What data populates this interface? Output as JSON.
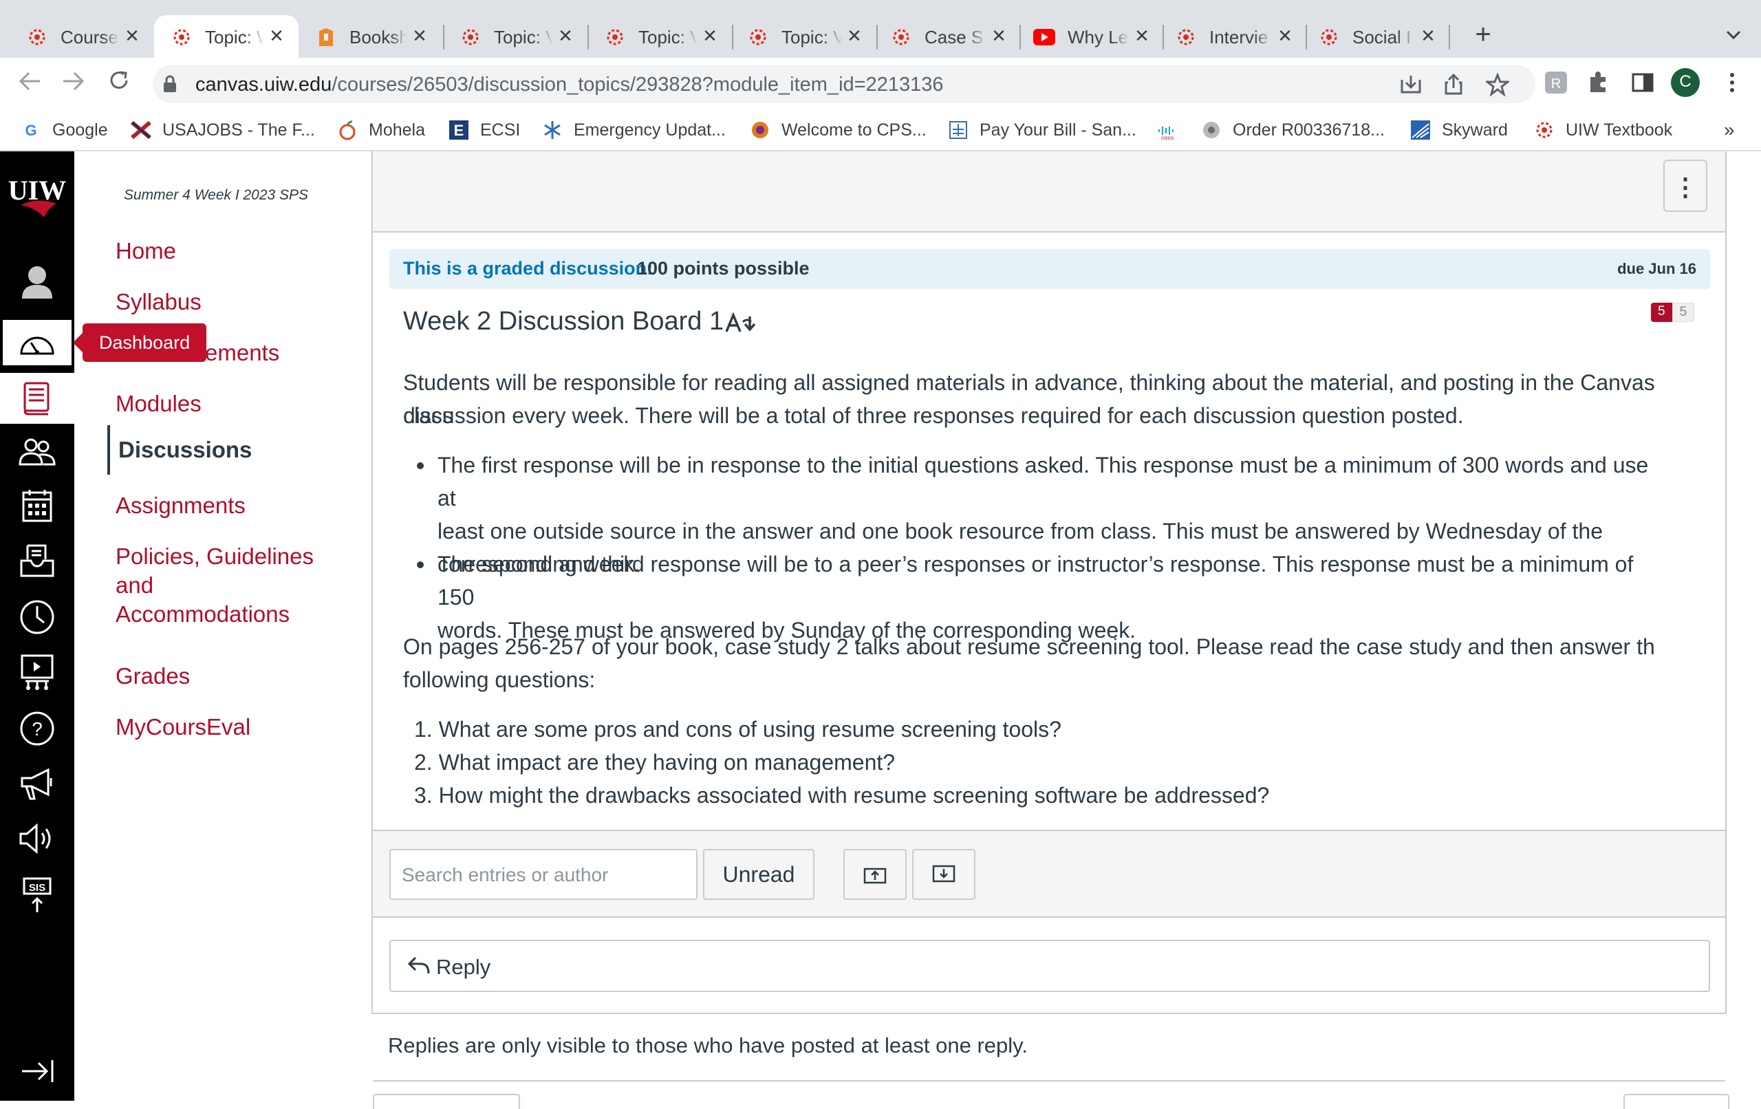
{
  "browser": {
    "tabs": [
      {
        "title": "Course",
        "icon": "canvas-icon",
        "active": false
      },
      {
        "title": "Topic: W",
        "icon": "canvas-icon",
        "active": true
      },
      {
        "title": "Booksh",
        "icon": "bookshelf-icon",
        "active": false
      },
      {
        "title": "Topic: V",
        "icon": "canvas-icon",
        "active": false
      },
      {
        "title": "Topic: V",
        "icon": "canvas-icon",
        "active": false
      },
      {
        "title": "Topic: V",
        "icon": "canvas-icon",
        "active": false
      },
      {
        "title": "Case S",
        "icon": "canvas-icon",
        "active": false
      },
      {
        "title": "Why Le",
        "icon": "youtube-icon",
        "active": false
      },
      {
        "title": "Intervie",
        "icon": "canvas-icon",
        "active": false
      },
      {
        "title": "Social I",
        "icon": "canvas-icon",
        "active": false
      }
    ],
    "new_tab_label": "+",
    "url_host": "canvas.uiw.edu",
    "url_path": "/courses/26503/discussion_topics/293828?module_item_id=2213136",
    "profile_initial": "C",
    "bookmarks": [
      {
        "label": "Google",
        "icon": "google-icon"
      },
      {
        "label": "USAJOBS - The F...",
        "icon": "usajobs-icon"
      },
      {
        "label": "Mohela",
        "icon": "mohela-icon"
      },
      {
        "label": "ECSI",
        "icon": "ecsi-icon"
      },
      {
        "label": "Emergency Updat...",
        "icon": "snowflake-icon"
      },
      {
        "label": "Welcome to CPS...",
        "icon": "cps-icon"
      },
      {
        "label": "Pay Your Bill - San...",
        "icon": "bill-icon"
      },
      {
        "label": "",
        "icon": "cisco-icon"
      },
      {
        "label": "Order R00336718...",
        "icon": "order-icon"
      },
      {
        "label": "Skyward",
        "icon": "skyward-icon"
      },
      {
        "label": "UIW Textbook",
        "icon": "canvas-icon"
      }
    ],
    "bookmarks_overflow": "»"
  },
  "global_nav": {
    "logo_text": "UIW",
    "tooltip": "Dashboard"
  },
  "course_nav": {
    "term": "Summer 4 Week I 2023 SPS",
    "links": [
      {
        "label": "Home"
      },
      {
        "label": "Syllabus"
      },
      {
        "label": "Announcements"
      },
      {
        "label": "Modules"
      },
      {
        "label": "Discussions",
        "current": true
      },
      {
        "label": "Assignments"
      },
      {
        "label": "Policies, Guidelines and Accommodations"
      },
      {
        "label": "Grades"
      },
      {
        "label": "MyCoursEval"
      }
    ],
    "partial_announcements_visible": "ements",
    "policies_line1": "Policies, Guidelines",
    "policies_line2": "and",
    "policies_line3": "Accommodations"
  },
  "discussion": {
    "graded_label": "This is a graded discussion:",
    "points": "100 points possible",
    "due": "due Jun 16",
    "badge_unread": "5",
    "badge_total": "5",
    "title": "Week 2 Discussion Board 1",
    "intro_line1": "Students will be responsible for reading all assigned materials in advance, thinking about the material, and posting in the Canvas class",
    "intro_line2": "discussion every week. There will be a total of three responses required for each discussion question posted.",
    "bullet1_line1": "The first response will be in response to the initial questions asked. This response must be a minimum of 300 words and use at",
    "bullet1_line2": "least one outside source in the answer and one book resource from class. This must be answered by Wednesday of the",
    "bullet1_line3": "corresponding week.",
    "bullet2_line1": "The second and third response will be to a peer’s responses or instructor’s response. This response must be a minimum of 150",
    "bullet2_line2": "words. These must be answered by Sunday of the corresponding week.",
    "case_line1": "On pages 256-257 of your book, case study 2 talks about resume screening tool. Please read the case study and then answer th",
    "case_line2": "following questions:",
    "questions": [
      "1. What are some pros and cons of using resume screening tools?",
      "2. What impact are they having on management?",
      "3. How might the drawbacks associated with resume screening software be addressed?"
    ]
  },
  "toolbar": {
    "search_placeholder": "Search entries or author",
    "unread_label": "Unread"
  },
  "reply": {
    "label": "Reply",
    "note": "Replies are only visible to those who have posted at least one reply."
  },
  "colors": {
    "canvas_red": "#b00e2b",
    "tooltip_red": "#c0102a",
    "link_blue": "#0374b5",
    "text": "#2d3b45"
  }
}
